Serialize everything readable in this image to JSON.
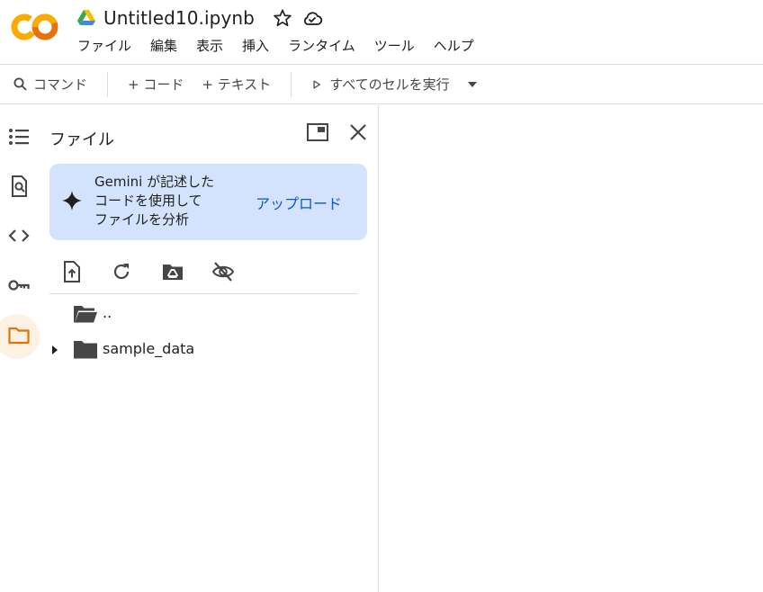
{
  "app": {
    "doc_title": "Untitled10.ipynb",
    "brand_color": "#f9ab00"
  },
  "menu": {
    "items": [
      "ファイル",
      "編集",
      "表示",
      "挿入",
      "ランタイム",
      "ツール",
      "ヘルプ"
    ]
  },
  "toolbar": {
    "command_label": "コマンド",
    "add_code_label": "+ コード",
    "add_text_label": "+ テキスト",
    "run_all_label": "すべてのセルを実行"
  },
  "rail": {
    "icons": [
      "toc-icon",
      "find-icon",
      "code-snippets-icon",
      "secrets-key-icon",
      "files-folder-icon"
    ],
    "active": "files-folder-icon",
    "active_color": "#e37400"
  },
  "files_panel": {
    "title": "ファイル",
    "gemini_card": {
      "lines": [
        "Gemini が記述した",
        "コードを使用して",
        "ファイルを分析"
      ],
      "upload_label": "アップロード"
    },
    "entries": [
      {
        "name": "..",
        "type": "folder-open",
        "expandable": false
      },
      {
        "name": "sample_data",
        "type": "folder",
        "expandable": true
      }
    ]
  }
}
